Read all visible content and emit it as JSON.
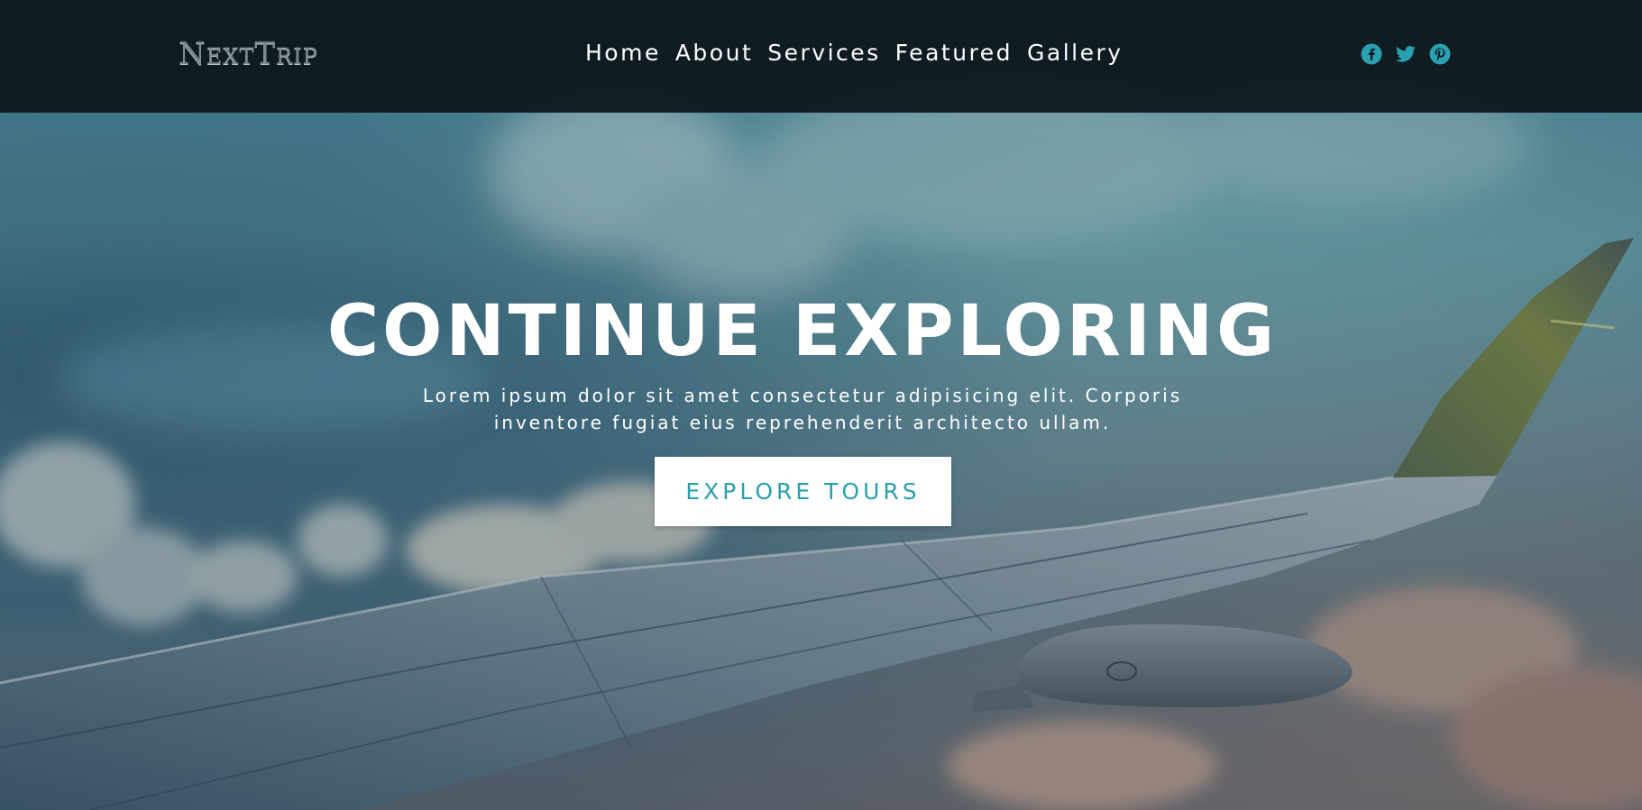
{
  "header": {
    "logo_text": "NextTrip",
    "nav": [
      {
        "label": "Home"
      },
      {
        "label": "About"
      },
      {
        "label": "Services"
      },
      {
        "label": "Featured"
      },
      {
        "label": "Gallery"
      }
    ],
    "social": [
      {
        "icon": "facebook-icon"
      },
      {
        "icon": "twitter-icon"
      },
      {
        "icon": "pinterest-icon"
      }
    ]
  },
  "hero": {
    "title": "CONTINUE EXPLORING",
    "subtitle": "Lorem ipsum dolor sit amet consectetur adipisicing elit. Corporis inventore fugiat eius reprehenderit architecto ullam.",
    "cta_label": "EXPLORE TOURS"
  },
  "colors": {
    "header_bg": "#0d181c",
    "accent": "#2a9fb0",
    "text": "#ffffff"
  }
}
